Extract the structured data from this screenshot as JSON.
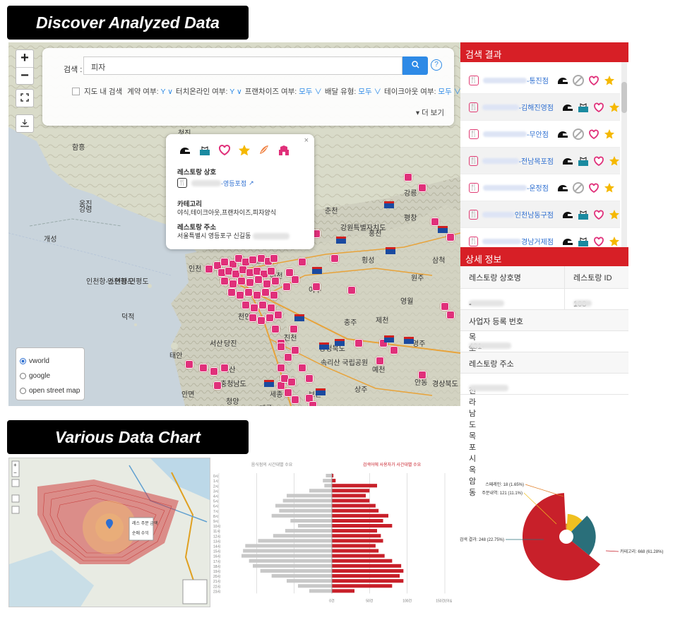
{
  "banner_top": "Discover Analyzed Data",
  "banner_bottom": "Various Data Chart",
  "map": {
    "zoom_in": "+",
    "zoom_out": "−",
    "search_label": "검색 :",
    "search_value": "피자",
    "filter_prefix": "지도 내 검색",
    "filters": [
      {
        "label": "계약 여부:",
        "value": "Y"
      },
      {
        "label": "터치온라인 여부:",
        "value": "Y"
      },
      {
        "label": "프랜차이즈 여부:",
        "value": "모두"
      },
      {
        "label": "배달 유형:",
        "value": "모두"
      },
      {
        "label": "테이크아웃 여부:",
        "value": "모두"
      }
    ],
    "more_label": "▾ 더 보기",
    "place_labels": [
      "춘천",
      "강원특별자치도",
      "홍천",
      "횡성",
      "원주",
      "여주",
      "충주",
      "제천",
      "영월",
      "영주",
      "서산",
      "당진",
      "진천",
      "충청북도",
      "속리산 국립공원",
      "예산",
      "충청남도",
      "세종",
      "보은",
      "청양",
      "계룡",
      "상주",
      "예천",
      "안동",
      "경상북도",
      "삼척",
      "평창",
      "강릉",
      "인천",
      "서울",
      "이천",
      "천안",
      "옹진",
      "강령",
      "함흥",
      "청진",
      "개성",
      "인천항-소연평도",
      "인천항-연평도",
      "덕적",
      "태안",
      "안면"
    ],
    "popup": {
      "close": "×",
      "name_title": "레스토랑 상호",
      "name_value": "-영등포점",
      "category_title": "카테고리",
      "category_value": "야식,테이크아웃,프랜차이즈,피자양식",
      "address_title": "레스토랑 주소",
      "address_value": "서울특별시 영등포구 신길동"
    },
    "layers": [
      "vworld",
      "google",
      "open street map"
    ],
    "layer_selected": "vworld"
  },
  "results": {
    "title": "검색 결과",
    "items": [
      {
        "name": "-통진점"
      },
      {
        "name": "-김해진영점"
      },
      {
        "name": "-무안점"
      },
      {
        "name": "-전남목포점"
      },
      {
        "name": "-운정점"
      },
      {
        "name": "인천남동구점"
      },
      {
        "name": "경남거제점"
      }
    ]
  },
  "detail": {
    "title": "상세 정보",
    "name_label": "레스토랑 상호명",
    "id_label": "레스토랑 ID",
    "name_value": "-전남목포점",
    "id_value": "108",
    "biz_label": "사업자 등록 번호",
    "biz_value": "431-",
    "addr_label": "레스토랑 주소",
    "addr_value": "전라남도 목포시 옥암동"
  },
  "charts": {
    "popup_small": [
      "레스 주문 금액",
      "순매 수익"
    ],
    "pyramid_left_title": "음식점의 시간대별 수요",
    "pyramid_right_title": "검색어에 사용자가 사간대별 수요",
    "pyramid_ticks": [
      "0건",
      "50건",
      "100건",
      "150건(이상)"
    ],
    "pie_labels": [
      "스페레인: 18 (1.65%)",
      "주문내역: 121 (11.1%)",
      "검색 결과: 248 (22.75%)",
      "카테고리: 668 (61.28%)"
    ]
  },
  "chart_data": [
    {
      "type": "bar",
      "title": "",
      "categories": [
        "0시",
        "1시",
        "2시",
        "3시",
        "4시",
        "5시",
        "6시",
        "7시",
        "8시",
        "9시",
        "10시",
        "11시",
        "12시",
        "13시",
        "14시",
        "15시",
        "16시",
        "17시",
        "18시",
        "19시",
        "20시",
        "21시",
        "22시",
        "23시"
      ],
      "series": [
        {
          "name": "음식점의 시간대별 수요",
          "values": [
            8,
            12,
            10,
            30,
            60,
            65,
            75,
            70,
            80,
            55,
            45,
            62,
            78,
            98,
            115,
            118,
            120,
            110,
            105,
            95,
            80,
            60,
            45,
            30
          ]
        },
        {
          "name": "검색어에 사용자가 사간대별 수요",
          "values": [
            2,
            5,
            60,
            50,
            45,
            50,
            58,
            62,
            75,
            68,
            80,
            60,
            65,
            68,
            58,
            62,
            70,
            80,
            92,
            95,
            90,
            95,
            80,
            30
          ]
        }
      ],
      "xlim": [
        0,
        150
      ]
    },
    {
      "type": "pie",
      "title": "",
      "labels": [
        "스페레인",
        "주문내역",
        "검색 결과",
        "카테고리"
      ],
      "values": [
        18,
        121,
        248,
        668
      ],
      "colors": [
        "#e07b20",
        "#f0c020",
        "#2a6f7a",
        "#c8202a"
      ]
    }
  ]
}
